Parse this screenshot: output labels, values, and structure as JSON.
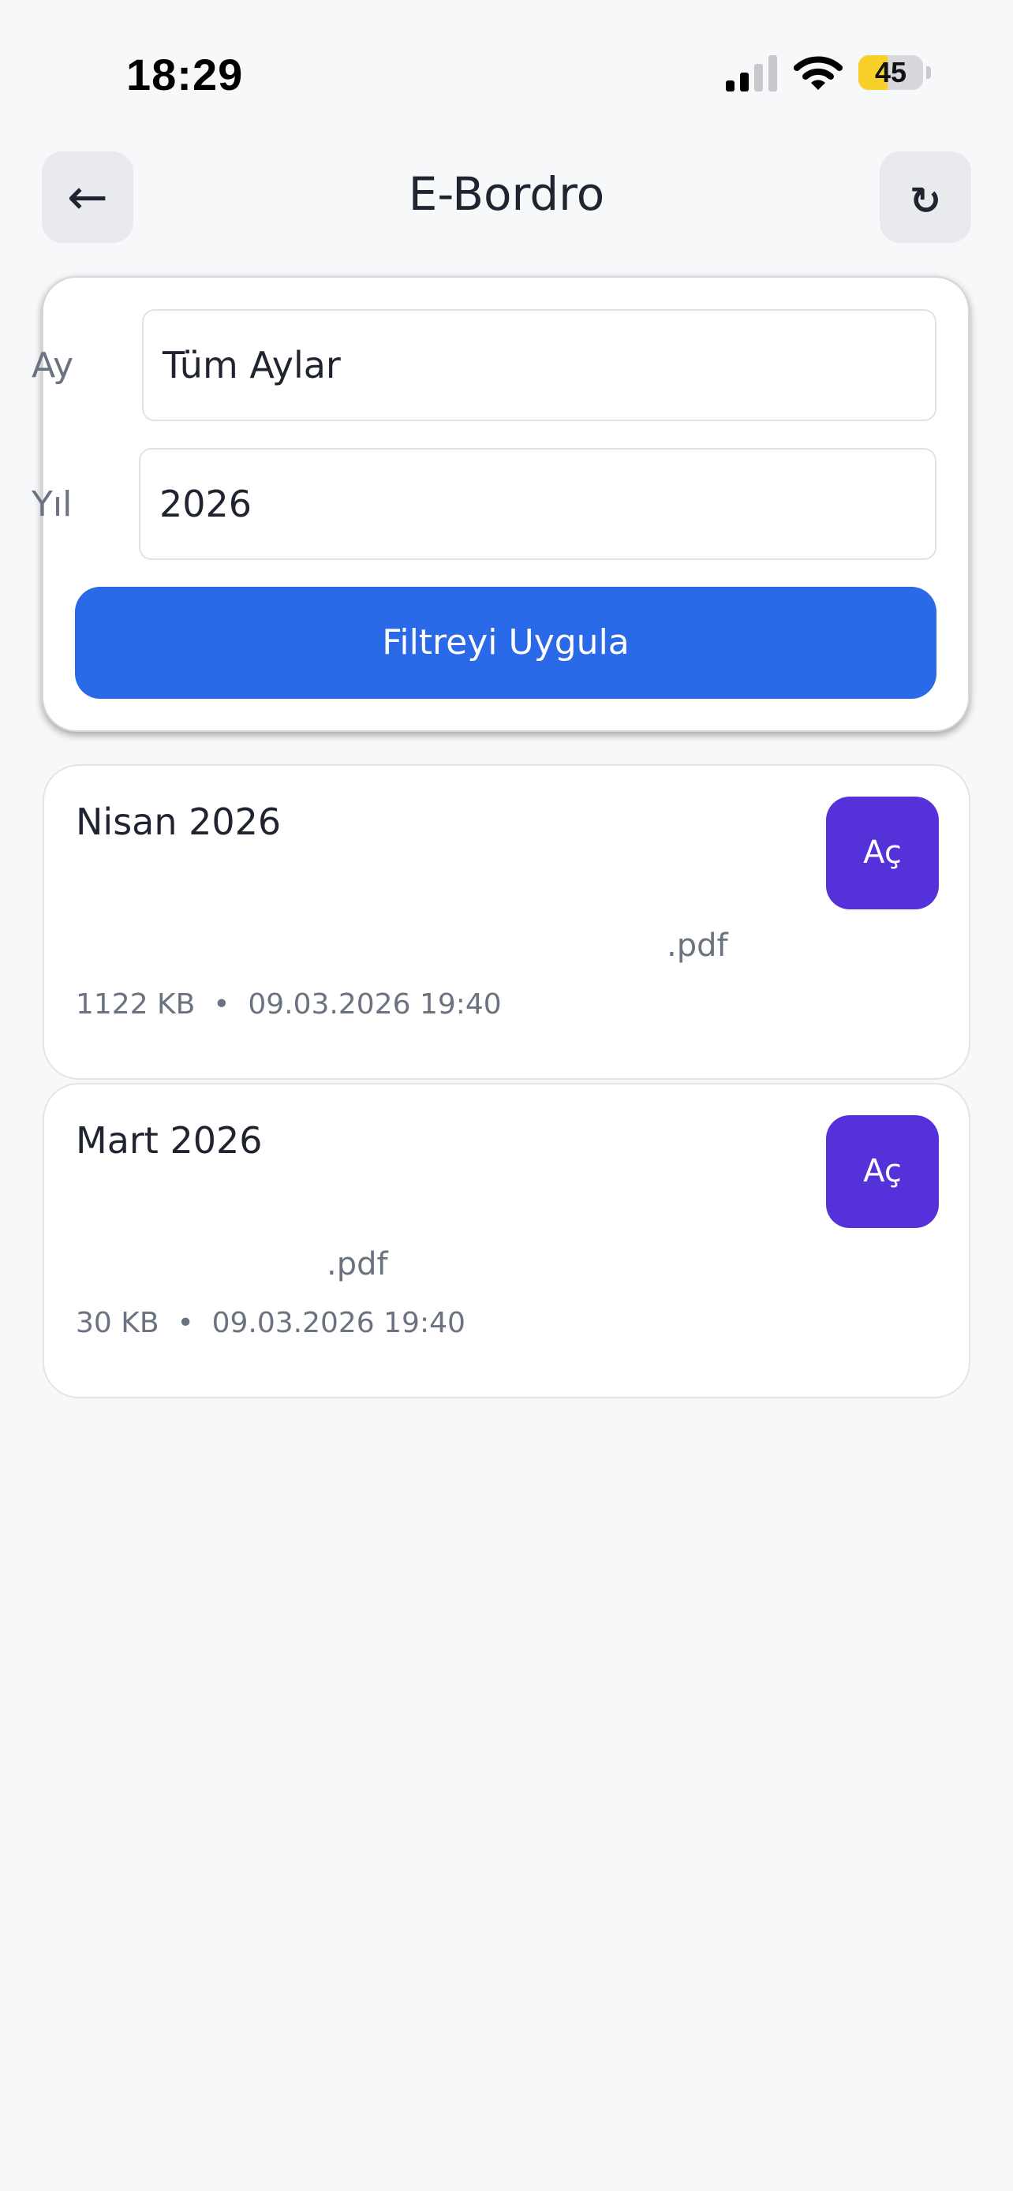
{
  "status_bar": {
    "time": "18:29",
    "battery_level": "45",
    "battery_fraction": 0.45,
    "icons": [
      "signal-icon",
      "wifi-icon",
      "battery-icon"
    ]
  },
  "header": {
    "title": "E-Bordro",
    "back_icon": "←",
    "refresh_icon": "↻"
  },
  "filter": {
    "month_label": "Ay",
    "month_value": "Tüm Aylar",
    "year_label": "Yıl",
    "year_value": "2026",
    "apply_label": "Filtreyi Uygula"
  },
  "payslips": [
    {
      "title": "Nisan 2026",
      "open_label": "Aç",
      "file_name": ".pdf",
      "meta": "1122 KB  •  09.03.2026 19:40"
    },
    {
      "title": "Mart 2026",
      "open_label": "Aç",
      "file_name": ".pdf",
      "meta": "30 KB  •  09.03.2026 19:40"
    }
  ],
  "colors": {
    "background": "#f7f8fa",
    "primary_button": "#2a69e8",
    "open_button": "#5431d8",
    "battery_fill": "#f7d02a"
  }
}
